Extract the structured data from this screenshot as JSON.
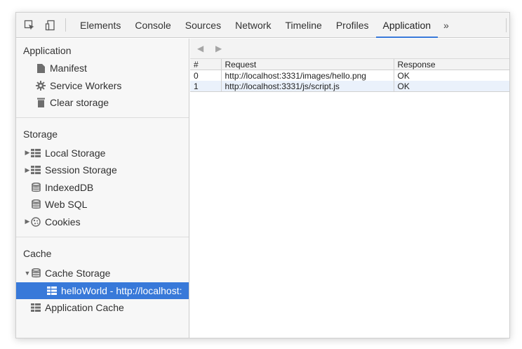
{
  "tabs": {
    "items": [
      "Elements",
      "Console",
      "Sources",
      "Network",
      "Timeline",
      "Profiles",
      "Application"
    ],
    "active": "Application",
    "more": "»"
  },
  "sidebar": {
    "application": {
      "title": "Application",
      "items": [
        "Manifest",
        "Service Workers",
        "Clear storage"
      ]
    },
    "storage": {
      "title": "Storage",
      "items": [
        "Local Storage",
        "Session Storage",
        "IndexedDB",
        "Web SQL",
        "Cookies"
      ]
    },
    "cache": {
      "title": "Cache",
      "items": [
        "Cache Storage",
        "helloWorld - http://localhost:",
        "Application Cache"
      ]
    }
  },
  "main": {
    "nav": {
      "back": "◀",
      "forward": "▶"
    },
    "columns": [
      "#",
      "Request",
      "Response"
    ],
    "rows": [
      {
        "index": "0",
        "request": "http://localhost:3331/images/hello.png",
        "response": "OK"
      },
      {
        "index": "1",
        "request": "http://localhost:3331/js/script.js",
        "response": "OK"
      }
    ]
  },
  "colors": {
    "accent": "#3879d9",
    "row_alt": "#eaf1fb"
  }
}
